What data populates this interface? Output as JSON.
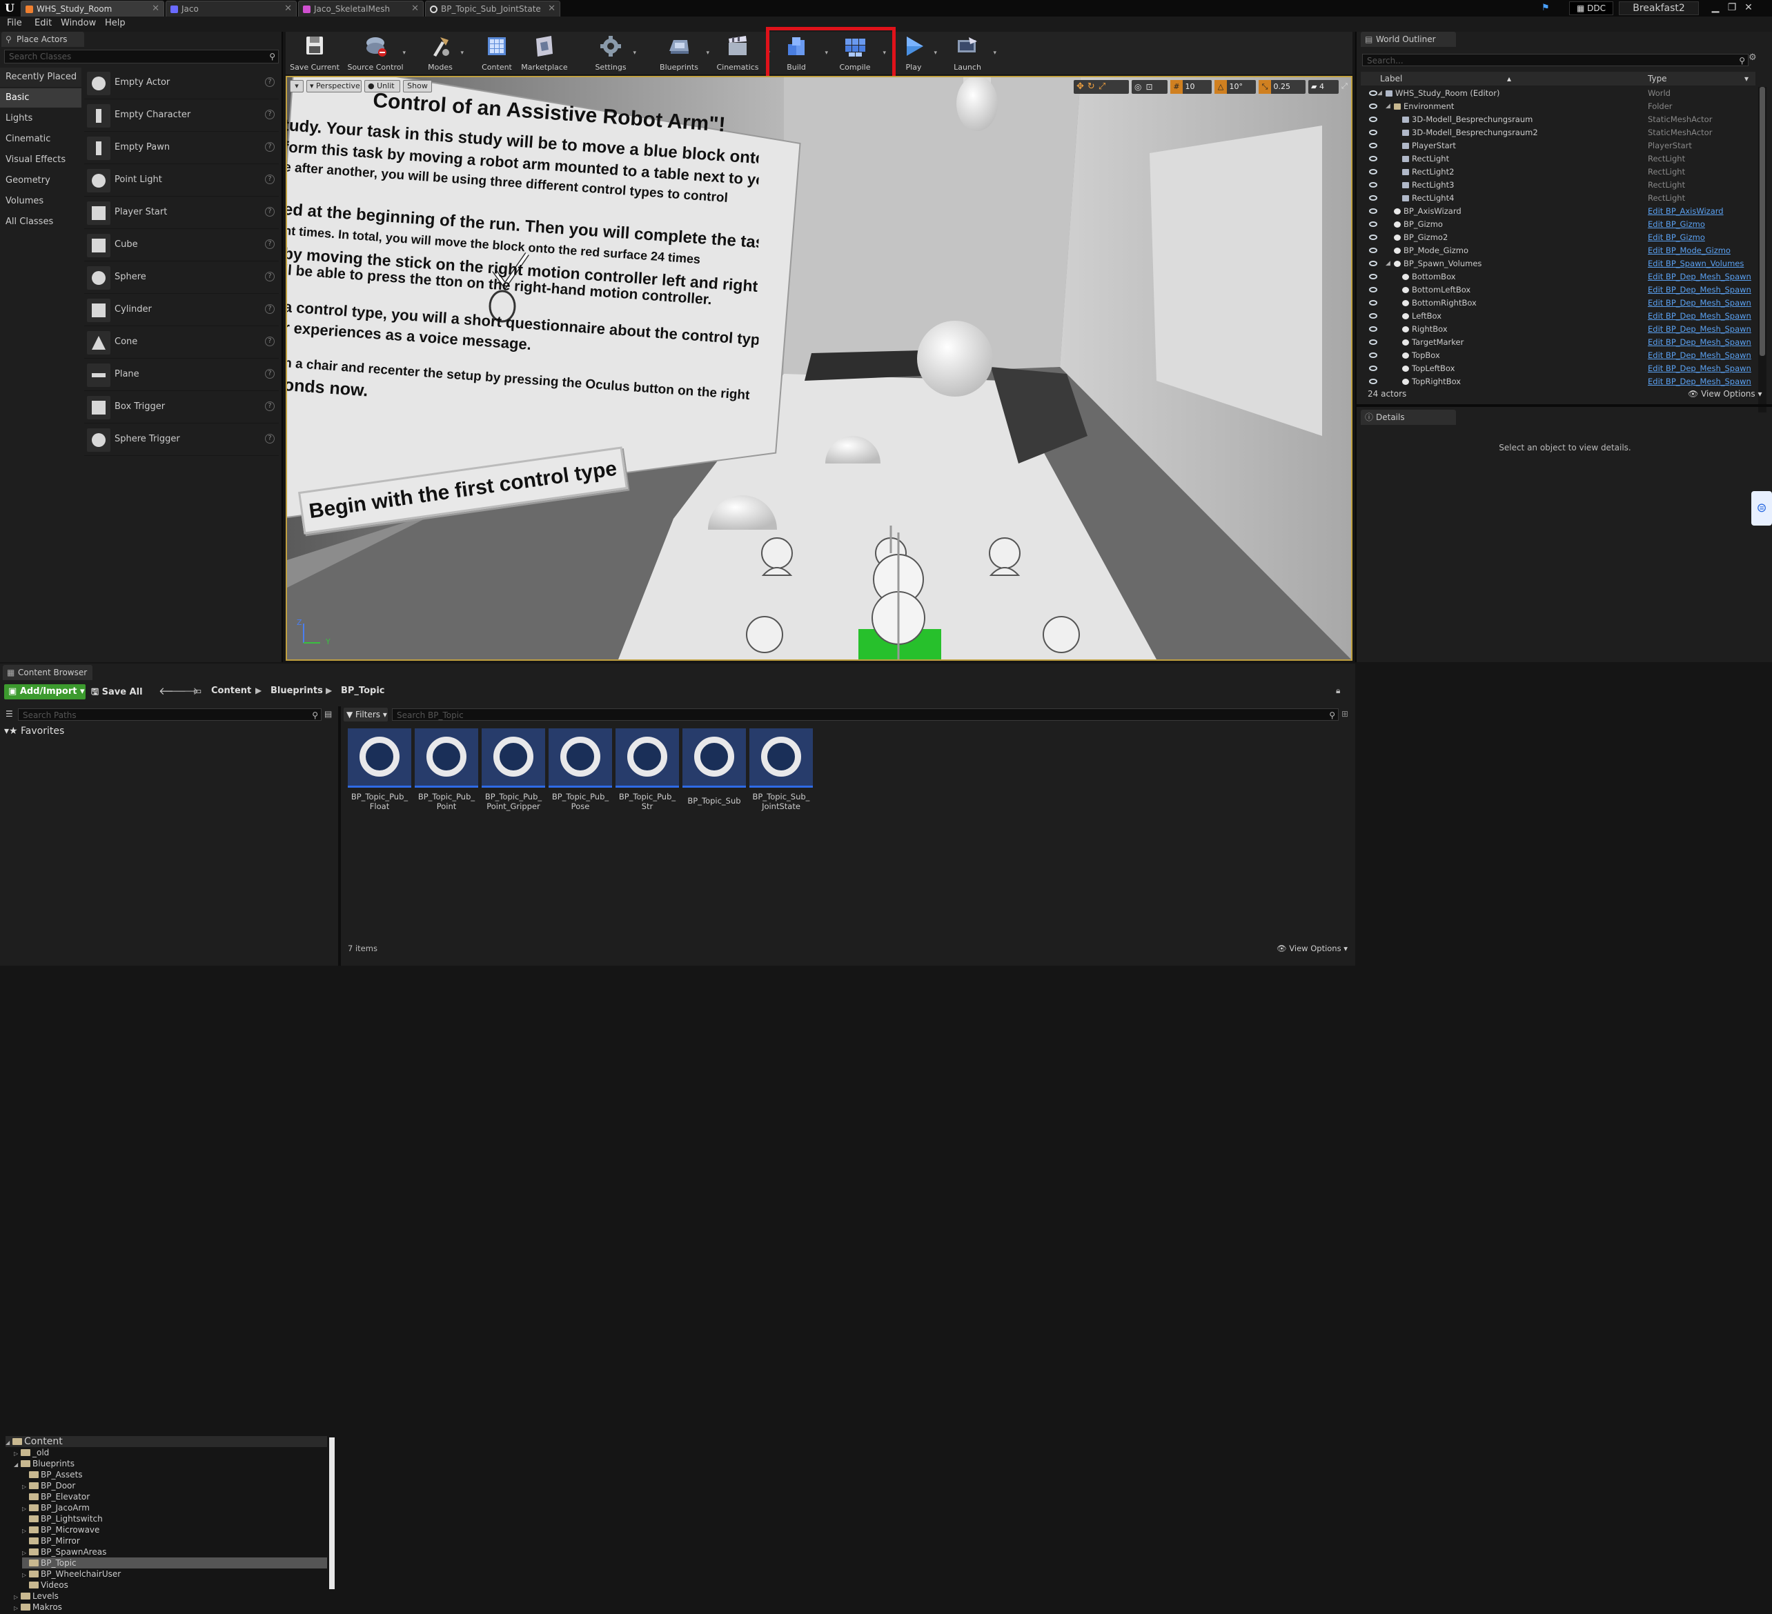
{
  "tabs": [
    {
      "label": "WHS_Study_Room",
      "active": true
    },
    {
      "label": "Jaco"
    },
    {
      "label": "Jaco_SkeletalMesh"
    },
    {
      "label": "BP_Topic_Sub_JointState"
    }
  ],
  "titlebar": {
    "ddc_label": "DDC",
    "project": "Breakfast2"
  },
  "menu": [
    "File",
    "Edit",
    "Window",
    "Help"
  ],
  "place_actors": {
    "tab_title": "Place Actors",
    "search_placeholder": "Search Classes",
    "categories": [
      "Recently Placed",
      "Basic",
      "Lights",
      "Cinematic",
      "Visual Effects",
      "Geometry",
      "Volumes",
      "All Classes"
    ],
    "selected_category": "Basic",
    "actors": [
      "Empty Actor",
      "Empty Character",
      "Empty Pawn",
      "Point Light",
      "Player Start",
      "Cube",
      "Sphere",
      "Cylinder",
      "Cone",
      "Plane",
      "Box Trigger",
      "Sphere Trigger"
    ]
  },
  "toolbar": {
    "buttons": [
      "Save Current",
      "Source Control",
      "Modes",
      "Content",
      "Marketplace",
      "Settings",
      "Blueprints",
      "Cinematics",
      "Build",
      "Compile",
      "Play",
      "Launch"
    ]
  },
  "viewport": {
    "perspective": "Perspective",
    "lit": "Unlit",
    "show": "Show",
    "grid_snap": "10",
    "rot_snap": "10°",
    "scale_snap": "0.25",
    "camera_speed": "4",
    "scene_text": [
      "Control of an Assistive Robot Arm\"!",
      "tudy. Your task in this study will be to move a blue block onto a red",
      "form this task by moving a robot arm mounted to a table next to you",
      "e after another, you will be using three different control types to control",
      "ed at the beginning of the run. Then you will complete the task (move the",
      "ht times. In total, you will move the block onto the red surface 24 times",
      "by moving the stick on the right motion controller left and right as well as",
      "ll be able to press the          tton on the right-hand motion controller.",
      "a control type, you will         a short questionnaire about the control type and",
      "r experiences as a voice message.",
      "n a chair and recenter the setup by pressing the Oculus button on the right",
      "onds now."
    ],
    "begin_button": "Begin with the first control type",
    "axis_labels": {
      "z": "Z",
      "y": "Y"
    }
  },
  "outliner": {
    "tab_title": "World Outliner",
    "search_placeholder": "Search...",
    "col_label": "Label",
    "col_type": "Type",
    "rows": [
      {
        "name": "WHS_Study_Room (Editor)",
        "type": "World",
        "indent": 0,
        "link": false
      },
      {
        "name": "Environment",
        "type": "Folder",
        "indent": 1,
        "link": false
      },
      {
        "name": "3D-Modell_Besprechungsraum",
        "type": "StaticMeshActor",
        "indent": 2,
        "link": false
      },
      {
        "name": "3D-Modell_Besprechungsraum2",
        "type": "StaticMeshActor",
        "indent": 2,
        "link": false
      },
      {
        "name": "PlayerStart",
        "type": "PlayerStart",
        "indent": 2,
        "link": false
      },
      {
        "name": "RectLight",
        "type": "RectLight",
        "indent": 2,
        "link": false
      },
      {
        "name": "RectLight2",
        "type": "RectLight",
        "indent": 2,
        "link": false
      },
      {
        "name": "RectLight3",
        "type": "RectLight",
        "indent": 2,
        "link": false
      },
      {
        "name": "RectLight4",
        "type": "RectLight",
        "indent": 2,
        "link": false
      },
      {
        "name": "BP_AxisWizard",
        "type": "Edit BP_AxisWizard",
        "indent": 1,
        "link": true
      },
      {
        "name": "BP_Gizmo",
        "type": "Edit BP_Gizmo",
        "indent": 1,
        "link": true
      },
      {
        "name": "BP_Gizmo2",
        "type": "Edit BP_Gizmo",
        "indent": 1,
        "link": true
      },
      {
        "name": "BP_Mode_Gizmo",
        "type": "Edit BP_Mode_Gizmo",
        "indent": 1,
        "link": true
      },
      {
        "name": "BP_Spawn_Volumes",
        "type": "Edit BP_Spawn_Volumes",
        "indent": 1,
        "link": true
      },
      {
        "name": "BottomBox",
        "type": "Edit BP_Dep_Mesh_Spawn",
        "indent": 2,
        "link": true
      },
      {
        "name": "BottomLeftBox",
        "type": "Edit BP_Dep_Mesh_Spawn",
        "indent": 2,
        "link": true
      },
      {
        "name": "BottomRightBox",
        "type": "Edit BP_Dep_Mesh_Spawn",
        "indent": 2,
        "link": true
      },
      {
        "name": "LeftBox",
        "type": "Edit BP_Dep_Mesh_Spawn",
        "indent": 2,
        "link": true
      },
      {
        "name": "RightBox",
        "type": "Edit BP_Dep_Mesh_Spawn",
        "indent": 2,
        "link": true
      },
      {
        "name": "TargetMarker",
        "type": "Edit BP_Dep_Mesh_Spawn",
        "indent": 2,
        "link": true
      },
      {
        "name": "TopBox",
        "type": "Edit BP_Dep_Mesh_Spawn",
        "indent": 2,
        "link": true
      },
      {
        "name": "TopLeftBox",
        "type": "Edit BP_Dep_Mesh_Spawn",
        "indent": 2,
        "link": true
      },
      {
        "name": "TopRightBox",
        "type": "Edit BP_Dep_Mesh_Spawn",
        "indent": 2,
        "link": true
      }
    ],
    "actor_count": "24 actors",
    "view_options": "View Options"
  },
  "details": {
    "tab_title": "Details",
    "empty_text": "Select an object to view details."
  },
  "content_browser": {
    "tab_title": "Content Browser",
    "add_import": "Add/Import",
    "save_all": "Save All",
    "path": [
      "Content",
      "Blueprints",
      "BP_Topic"
    ],
    "search_paths_placeholder": "Search Paths",
    "favorites": "Favorites",
    "filters": "Filters",
    "search_placeholder": "Search BP_Topic",
    "tree": [
      {
        "name": "Content",
        "indent": 0
      },
      {
        "name": "_old",
        "indent": 1
      },
      {
        "name": "Blueprints",
        "indent": 1
      },
      {
        "name": "BP_Assets",
        "indent": 2
      },
      {
        "name": "BP_Door",
        "indent": 2
      },
      {
        "name": "BP_Elevator",
        "indent": 2
      },
      {
        "name": "BP_JacoArm",
        "indent": 2
      },
      {
        "name": "BP_Lightswitch",
        "indent": 2
      },
      {
        "name": "BP_Microwave",
        "indent": 2
      },
      {
        "name": "BP_Mirror",
        "indent": 2
      },
      {
        "name": "BP_SpawnAreas",
        "indent": 2
      },
      {
        "name": "BP_Topic",
        "indent": 2,
        "selected": true
      },
      {
        "name": "BP_WheelchairUser",
        "indent": 2
      },
      {
        "name": "Videos",
        "indent": 2
      },
      {
        "name": "Levels",
        "indent": 1
      },
      {
        "name": "Makros",
        "indent": 1
      }
    ],
    "assets": [
      {
        "line1": "BP_Topic_Pub_",
        "line2": "Float"
      },
      {
        "line1": "BP_Topic_Pub_",
        "line2": "Point"
      },
      {
        "line1": "BP_Topic_Pub_",
        "line2": "Point_Gripper"
      },
      {
        "line1": "BP_Topic_Pub_",
        "line2": "Pose"
      },
      {
        "line1": "BP_Topic_Pub_",
        "line2": "Str"
      },
      {
        "line1": "BP_Topic_Sub",
        "line2": ""
      },
      {
        "line1": "BP_Topic_Sub_",
        "line2": "JointState"
      }
    ],
    "item_count": "7 items",
    "view_options": "View Options"
  },
  "colors": {
    "highlight": "#e0121a",
    "accent_green": "#3c9a2e",
    "link_blue": "#5aa0f0",
    "asset_blue": "#273c6b"
  }
}
